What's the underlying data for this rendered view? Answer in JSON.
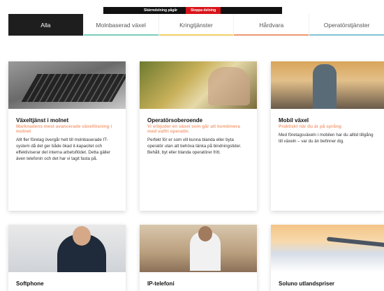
{
  "share_bar": {
    "status": "Skärmdelning pågår",
    "stop": "Stoppa delning"
  },
  "tabs": [
    {
      "label": "Alla",
      "color": "#1e1e1e"
    },
    {
      "label": "Molnbaserad växel",
      "color": "#7dd3c0"
    },
    {
      "label": "Kringtjänster",
      "color": "#f5d36b"
    },
    {
      "label": "Hårdvara",
      "color": "#f29b76"
    },
    {
      "label": "Operatörstjänster",
      "color": "#84c7d8"
    }
  ],
  "cards": [
    {
      "title": "Växeltjänst i molnet",
      "subtitle": "Marknadens mest avancerade växellösning i molnet",
      "text": "Allt fler företag övergår helt till molnbaserade IT-system då det ger både ökad it-kapacitet och effektiviserar det interna arbetsflödet. Detta gäller även telefonin och det har vi tagit fasta på."
    },
    {
      "title": "Operatörsoberoende",
      "subtitle": "Vi erbjuder en växel som går att kombinera med valfri operatör.",
      "text": "Perfekt för er som vill kunna blanda eller byta operatör utan att behöva tänka på bindningstider. Behåll, byt eller blanda operatörer fritt."
    },
    {
      "title": "Mobil växel",
      "subtitle": "Praktiskt när du är på språng",
      "text": "Med företagsväxeln i mobilen har du alltid tillgång till växeln – var du än befinner dig."
    },
    {
      "title": "Softphone",
      "subtitle": "",
      "text": ""
    },
    {
      "title": "IP-telefoni",
      "subtitle": "",
      "text": ""
    },
    {
      "title": "Soluno utlandspriser",
      "subtitle": "",
      "text": ""
    }
  ]
}
